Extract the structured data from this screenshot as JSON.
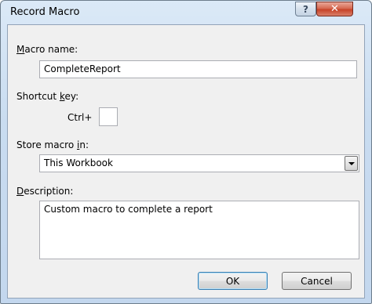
{
  "window": {
    "title": "Record Macro",
    "help_label": "?",
    "close_label": "✕"
  },
  "macro_name": {
    "label_access": "M",
    "label_rest": "acro name:",
    "value": "CompleteReport"
  },
  "shortcut": {
    "label_pre": "Shortcut ",
    "label_access": "k",
    "label_post": "ey:",
    "prefix": "Ctrl+",
    "value": ""
  },
  "store_in": {
    "label_pre": "Store macro ",
    "label_access": "i",
    "label_post": "n:",
    "selected": "This Workbook"
  },
  "description": {
    "label_access": "D",
    "label_rest": "escription:",
    "value": "Custom macro to complete a report"
  },
  "buttons": {
    "ok": "OK",
    "cancel": "Cancel"
  }
}
